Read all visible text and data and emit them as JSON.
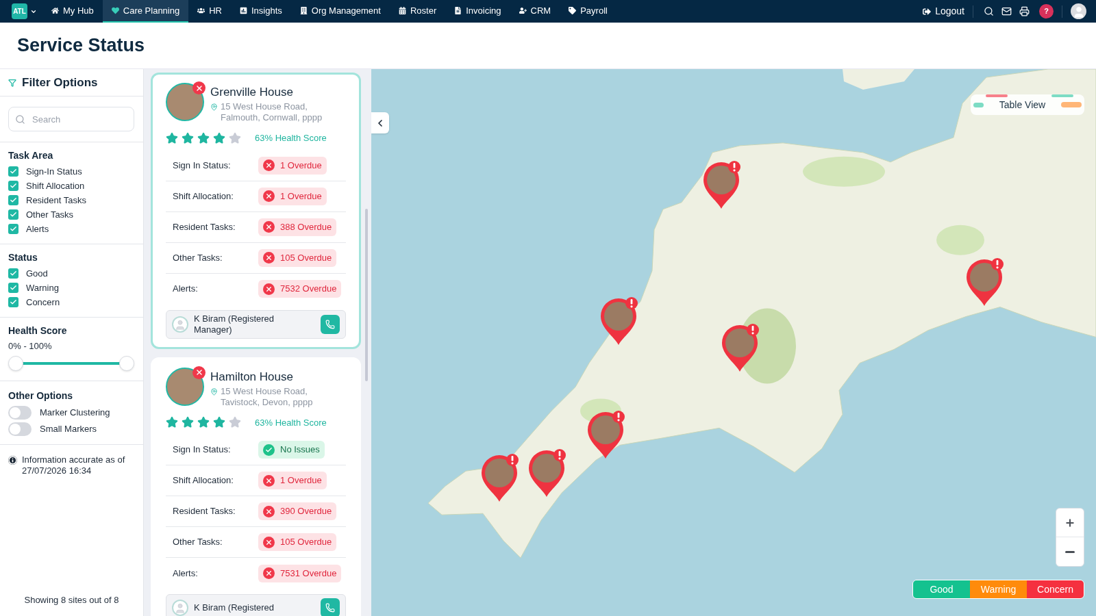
{
  "nav": {
    "logo": "ATL",
    "items": [
      {
        "label": "My Hub",
        "selected": false
      },
      {
        "label": "Care Planning",
        "selected": true
      },
      {
        "label": "HR",
        "selected": false
      },
      {
        "label": "Insights",
        "selected": false
      },
      {
        "label": "Org Management",
        "selected": false
      },
      {
        "label": "Roster",
        "selected": false
      },
      {
        "label": "Invoicing",
        "selected": false
      },
      {
        "label": "CRM",
        "selected": false
      },
      {
        "label": "Payroll",
        "selected": false
      }
    ],
    "logout": "Logout",
    "help": "?"
  },
  "page_title": "Service Status",
  "filters": {
    "title": "Filter Options",
    "search": {
      "placeholder": "Search"
    },
    "groups": [
      {
        "title": "Task Area",
        "options": [
          {
            "label": "Sign-In Status",
            "checked": true
          },
          {
            "label": "Shift Allocation",
            "checked": true
          },
          {
            "label": "Resident Tasks",
            "checked": true
          },
          {
            "label": "Other Tasks",
            "checked": true
          },
          {
            "label": "Alerts",
            "checked": true
          }
        ]
      },
      {
        "title": "Status",
        "options": [
          {
            "label": "Good",
            "checked": true
          },
          {
            "label": "Warning",
            "checked": true
          },
          {
            "label": "Concern",
            "checked": true
          }
        ]
      }
    ],
    "health_score": {
      "title": "Health Score",
      "range": "0% - 100%",
      "thumbs": [
        {
          "level": 0
        },
        {
          "level": 1
        }
      ]
    },
    "other_options": {
      "title": "Other Options",
      "toggles": [
        {
          "label": "Marker Clustering",
          "on": false
        },
        {
          "label": "Small Markers",
          "on": false
        }
      ]
    },
    "info": "Information accurate as of 27/07/2026 16:34",
    "footer": "Showing 8 sites out of 8"
  },
  "sites": [
    {
      "name": "Grenville House",
      "address": "15 West House Road, Falmouth, Cornwall, pppp",
      "flagged": true,
      "selected": true,
      "stars": 4,
      "health_score": "63% Health Score",
      "checks": [
        {
          "label": "Sign In Status:",
          "value": "1 Overdue",
          "ok": false
        },
        {
          "label": "Shift Allocation:",
          "value": "1 Overdue",
          "ok": false
        },
        {
          "label": "Resident Tasks:",
          "value": "388 Overdue",
          "ok": false
        },
        {
          "label": "Other Tasks:",
          "value": "105 Overdue",
          "ok": false
        },
        {
          "label": "Alerts:",
          "value": "7532 Overdue",
          "ok": false
        }
      ],
      "contact": "K Biram (Registered Manager)"
    },
    {
      "name": "Hamilton House",
      "address": "15 West House Road, Tavistock, Devon, pppp",
      "flagged": true,
      "selected": false,
      "stars": 4,
      "health_score": "63% Health Score",
      "checks": [
        {
          "label": "Sign In Status:",
          "value": "No Issues",
          "ok": true
        },
        {
          "label": "Shift Allocation:",
          "value": "1 Overdue",
          "ok": false
        },
        {
          "label": "Resident Tasks:",
          "value": "390 Overdue",
          "ok": false
        },
        {
          "label": "Other Tasks:",
          "value": "105 Overdue",
          "ok": false
        },
        {
          "label": "Alerts:",
          "value": "7531 Overdue",
          "ok": false
        }
      ],
      "contact": "K Biram (Registered"
    }
  ],
  "map": {
    "table_view": "Table View",
    "markers": [
      {
        "color": "#ef3340"
      },
      {
        "color": "#ef3340"
      },
      {
        "color": "#ef3340"
      },
      {
        "color": "#ef3340"
      },
      {
        "color": "#ef3340"
      },
      {
        "color": "#ef3340"
      },
      {
        "color": "#ef3340"
      }
    ],
    "legend": [
      {
        "label": "Good",
        "color": "#14c28f"
      },
      {
        "label": "Warning",
        "color": "#ff8b0b"
      },
      {
        "label": "Concern",
        "color": "#f5303f"
      }
    ]
  }
}
